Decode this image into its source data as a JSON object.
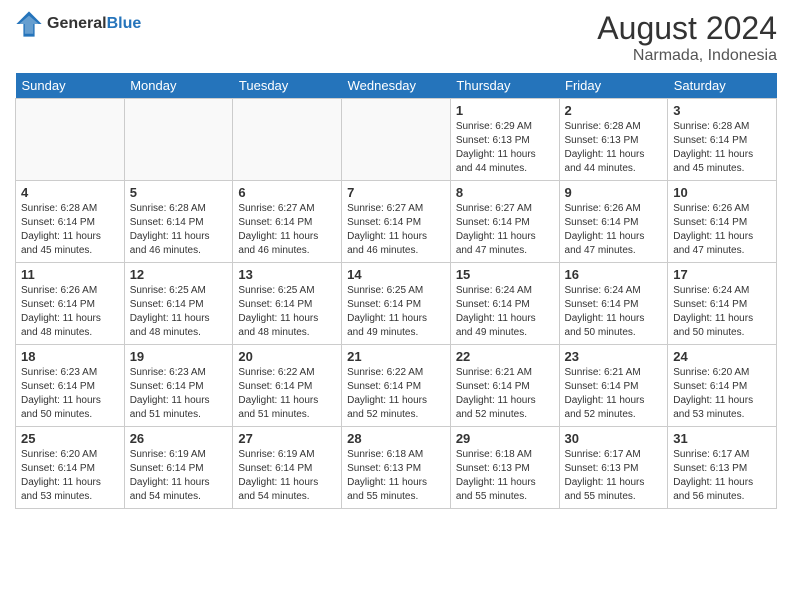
{
  "header": {
    "logo_line1": "General",
    "logo_line2": "Blue",
    "month_year": "August 2024",
    "location": "Narmada, Indonesia"
  },
  "days_of_week": [
    "Sunday",
    "Monday",
    "Tuesday",
    "Wednesday",
    "Thursday",
    "Friday",
    "Saturday"
  ],
  "weeks": [
    [
      {
        "day": "",
        "sunrise": "",
        "sunset": "",
        "daylight": ""
      },
      {
        "day": "",
        "sunrise": "",
        "sunset": "",
        "daylight": ""
      },
      {
        "day": "",
        "sunrise": "",
        "sunset": "",
        "daylight": ""
      },
      {
        "day": "",
        "sunrise": "",
        "sunset": "",
        "daylight": ""
      },
      {
        "day": "1",
        "sunrise": "Sunrise: 6:29 AM",
        "sunset": "Sunset: 6:13 PM",
        "daylight": "Daylight: 11 hours and 44 minutes."
      },
      {
        "day": "2",
        "sunrise": "Sunrise: 6:28 AM",
        "sunset": "Sunset: 6:13 PM",
        "daylight": "Daylight: 11 hours and 44 minutes."
      },
      {
        "day": "3",
        "sunrise": "Sunrise: 6:28 AM",
        "sunset": "Sunset: 6:14 PM",
        "daylight": "Daylight: 11 hours and 45 minutes."
      }
    ],
    [
      {
        "day": "4",
        "sunrise": "Sunrise: 6:28 AM",
        "sunset": "Sunset: 6:14 PM",
        "daylight": "Daylight: 11 hours and 45 minutes."
      },
      {
        "day": "5",
        "sunrise": "Sunrise: 6:28 AM",
        "sunset": "Sunset: 6:14 PM",
        "daylight": "Daylight: 11 hours and 46 minutes."
      },
      {
        "day": "6",
        "sunrise": "Sunrise: 6:27 AM",
        "sunset": "Sunset: 6:14 PM",
        "daylight": "Daylight: 11 hours and 46 minutes."
      },
      {
        "day": "7",
        "sunrise": "Sunrise: 6:27 AM",
        "sunset": "Sunset: 6:14 PM",
        "daylight": "Daylight: 11 hours and 46 minutes."
      },
      {
        "day": "8",
        "sunrise": "Sunrise: 6:27 AM",
        "sunset": "Sunset: 6:14 PM",
        "daylight": "Daylight: 11 hours and 47 minutes."
      },
      {
        "day": "9",
        "sunrise": "Sunrise: 6:26 AM",
        "sunset": "Sunset: 6:14 PM",
        "daylight": "Daylight: 11 hours and 47 minutes."
      },
      {
        "day": "10",
        "sunrise": "Sunrise: 6:26 AM",
        "sunset": "Sunset: 6:14 PM",
        "daylight": "Daylight: 11 hours and 47 minutes."
      }
    ],
    [
      {
        "day": "11",
        "sunrise": "Sunrise: 6:26 AM",
        "sunset": "Sunset: 6:14 PM",
        "daylight": "Daylight: 11 hours and 48 minutes."
      },
      {
        "day": "12",
        "sunrise": "Sunrise: 6:25 AM",
        "sunset": "Sunset: 6:14 PM",
        "daylight": "Daylight: 11 hours and 48 minutes."
      },
      {
        "day": "13",
        "sunrise": "Sunrise: 6:25 AM",
        "sunset": "Sunset: 6:14 PM",
        "daylight": "Daylight: 11 hours and 48 minutes."
      },
      {
        "day": "14",
        "sunrise": "Sunrise: 6:25 AM",
        "sunset": "Sunset: 6:14 PM",
        "daylight": "Daylight: 11 hours and 49 minutes."
      },
      {
        "day": "15",
        "sunrise": "Sunrise: 6:24 AM",
        "sunset": "Sunset: 6:14 PM",
        "daylight": "Daylight: 11 hours and 49 minutes."
      },
      {
        "day": "16",
        "sunrise": "Sunrise: 6:24 AM",
        "sunset": "Sunset: 6:14 PM",
        "daylight": "Daylight: 11 hours and 50 minutes."
      },
      {
        "day": "17",
        "sunrise": "Sunrise: 6:24 AM",
        "sunset": "Sunset: 6:14 PM",
        "daylight": "Daylight: 11 hours and 50 minutes."
      }
    ],
    [
      {
        "day": "18",
        "sunrise": "Sunrise: 6:23 AM",
        "sunset": "Sunset: 6:14 PM",
        "daylight": "Daylight: 11 hours and 50 minutes."
      },
      {
        "day": "19",
        "sunrise": "Sunrise: 6:23 AM",
        "sunset": "Sunset: 6:14 PM",
        "daylight": "Daylight: 11 hours and 51 minutes."
      },
      {
        "day": "20",
        "sunrise": "Sunrise: 6:22 AM",
        "sunset": "Sunset: 6:14 PM",
        "daylight": "Daylight: 11 hours and 51 minutes."
      },
      {
        "day": "21",
        "sunrise": "Sunrise: 6:22 AM",
        "sunset": "Sunset: 6:14 PM",
        "daylight": "Daylight: 11 hours and 52 minutes."
      },
      {
        "day": "22",
        "sunrise": "Sunrise: 6:21 AM",
        "sunset": "Sunset: 6:14 PM",
        "daylight": "Daylight: 11 hours and 52 minutes."
      },
      {
        "day": "23",
        "sunrise": "Sunrise: 6:21 AM",
        "sunset": "Sunset: 6:14 PM",
        "daylight": "Daylight: 11 hours and 52 minutes."
      },
      {
        "day": "24",
        "sunrise": "Sunrise: 6:20 AM",
        "sunset": "Sunset: 6:14 PM",
        "daylight": "Daylight: 11 hours and 53 minutes."
      }
    ],
    [
      {
        "day": "25",
        "sunrise": "Sunrise: 6:20 AM",
        "sunset": "Sunset: 6:14 PM",
        "daylight": "Daylight: 11 hours and 53 minutes."
      },
      {
        "day": "26",
        "sunrise": "Sunrise: 6:19 AM",
        "sunset": "Sunset: 6:14 PM",
        "daylight": "Daylight: 11 hours and 54 minutes."
      },
      {
        "day": "27",
        "sunrise": "Sunrise: 6:19 AM",
        "sunset": "Sunset: 6:14 PM",
        "daylight": "Daylight: 11 hours and 54 minutes."
      },
      {
        "day": "28",
        "sunrise": "Sunrise: 6:18 AM",
        "sunset": "Sunset: 6:13 PM",
        "daylight": "Daylight: 11 hours and 55 minutes."
      },
      {
        "day": "29",
        "sunrise": "Sunrise: 6:18 AM",
        "sunset": "Sunset: 6:13 PM",
        "daylight": "Daylight: 11 hours and 55 minutes."
      },
      {
        "day": "30",
        "sunrise": "Sunrise: 6:17 AM",
        "sunset": "Sunset: 6:13 PM",
        "daylight": "Daylight: 11 hours and 55 minutes."
      },
      {
        "day": "31",
        "sunrise": "Sunrise: 6:17 AM",
        "sunset": "Sunset: 6:13 PM",
        "daylight": "Daylight: 11 hours and 56 minutes."
      }
    ]
  ]
}
